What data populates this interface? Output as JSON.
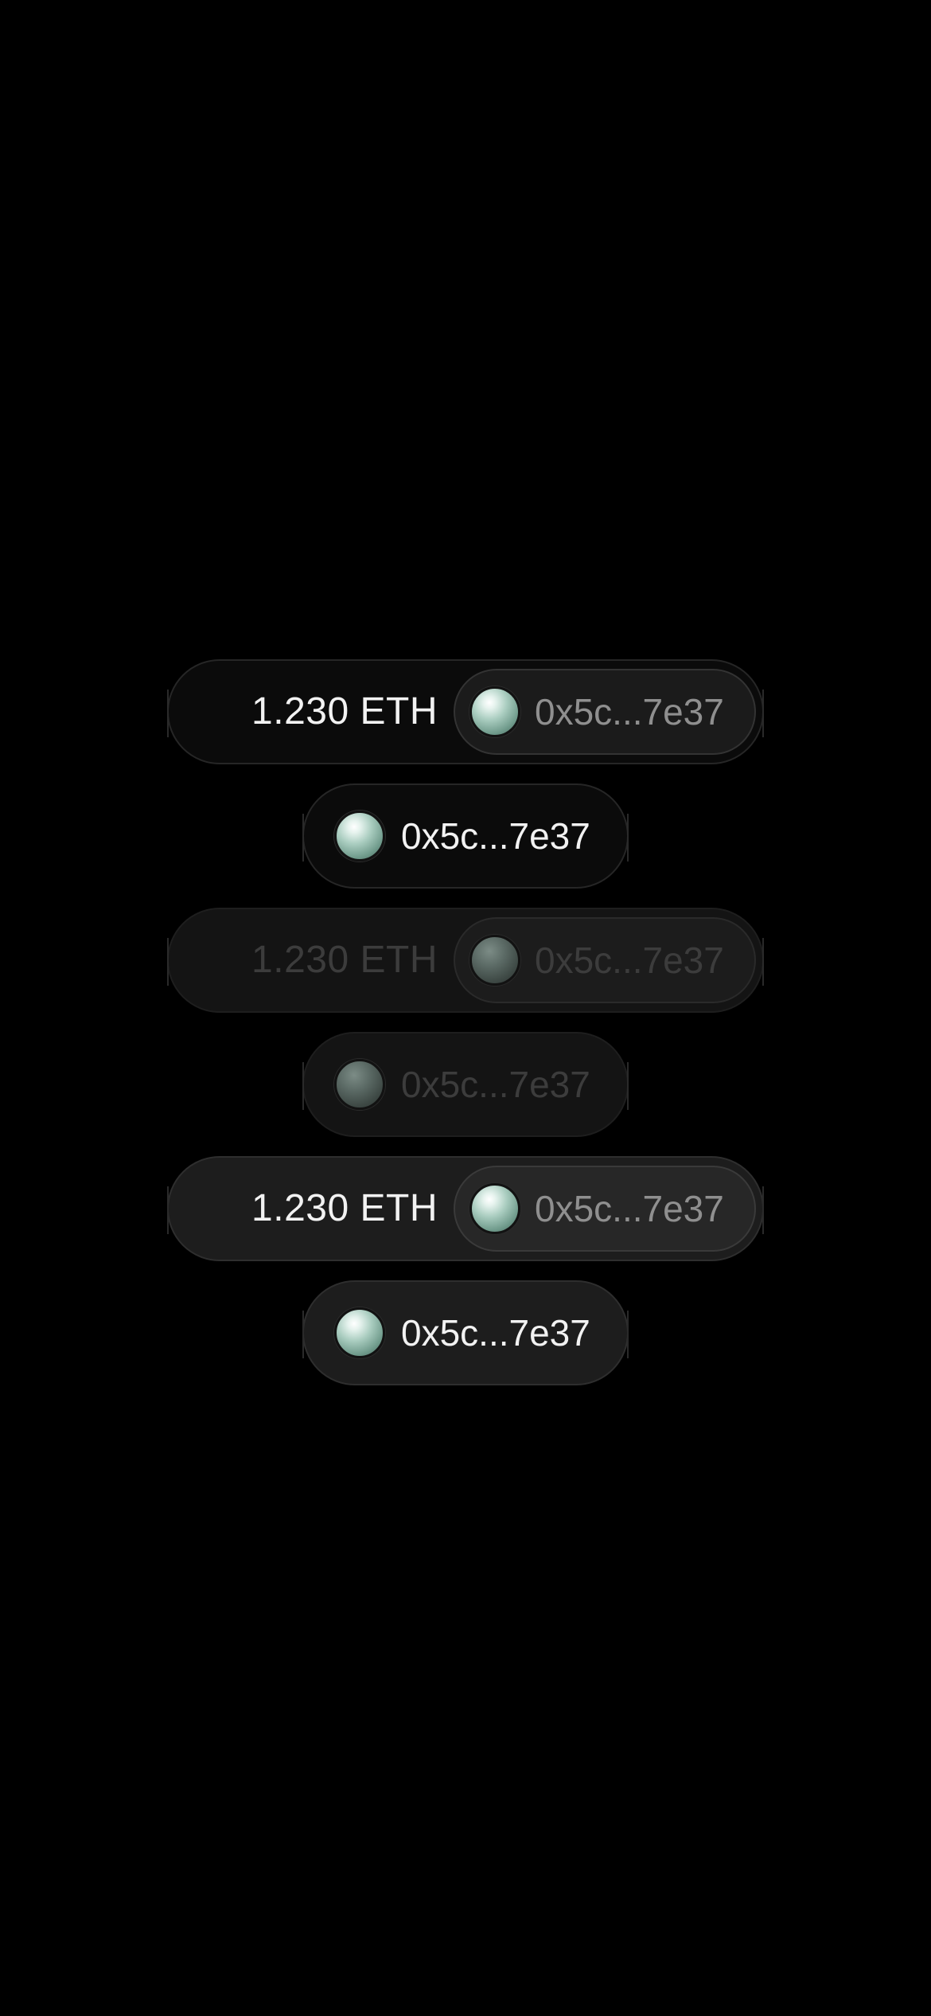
{
  "variants": [
    {
      "state": "default",
      "balance": "1.230 ETH",
      "address": "0x5c...7e37",
      "address_only": "0x5c...7e37"
    },
    {
      "state": "disabled",
      "balance": "1.230 ETH",
      "address": "0x5c...7e37",
      "address_only": "0x5c...7e37"
    },
    {
      "state": "pressed",
      "balance": "1.230 ETH",
      "address": "0x5c...7e37",
      "address_only": "0x5c...7e37"
    }
  ],
  "icons": {
    "avatar": "wallet-avatar-orb-icon"
  },
  "colors": {
    "background": "#000000",
    "primary_text": "#f2f2f2",
    "secondary_text": "#8f8f8f",
    "disabled_text": "#3c3c3c",
    "avatar_accent": "#aacdc0"
  }
}
